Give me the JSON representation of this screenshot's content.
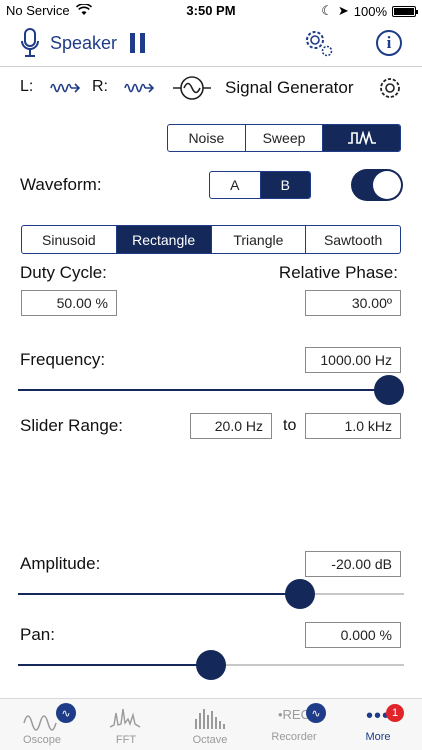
{
  "status_bar": {
    "carrier": "No Service",
    "time": "3:50 PM",
    "battery": "100%"
  },
  "header": {
    "output_label": "Speaker"
  },
  "channels": {
    "left": "L:",
    "right": "R:",
    "title": "Signal Generator"
  },
  "mode_tabs": [
    {
      "label": "Noise",
      "selected": false
    },
    {
      "label": "Sweep",
      "selected": false
    },
    {
      "label": "",
      "selected": true
    }
  ],
  "waveform": {
    "label": "Waveform:",
    "ab": [
      {
        "label": "A",
        "selected": false
      },
      {
        "label": "B",
        "selected": true
      }
    ],
    "toggle_on": true,
    "types": [
      {
        "label": "Sinusoid",
        "selected": false
      },
      {
        "label": "Rectangle",
        "selected": true
      },
      {
        "label": "Triangle",
        "selected": false
      },
      {
        "label": "Sawtooth",
        "selected": false
      }
    ]
  },
  "duty_cycle": {
    "label": "Duty Cycle:",
    "value": "50.00 %"
  },
  "relative_phase": {
    "label": "Relative Phase:",
    "value": "30.00º"
  },
  "frequency": {
    "label": "Frequency:",
    "value": "1000.00 Hz",
    "slider_fraction": 1.0
  },
  "slider_range": {
    "label": "Slider Range:",
    "from": "20.0 Hz",
    "to_label": "to",
    "to": "1.0 kHz"
  },
  "amplitude": {
    "label": "Amplitude:",
    "value": "-20.00 dB",
    "slider_fraction": 0.73
  },
  "pan": {
    "label": "Pan:",
    "value": "0.000 %",
    "slider_fraction": 0.5
  },
  "tab_bar": [
    {
      "label": "Oscope",
      "active": false
    },
    {
      "label": "FFT",
      "active": false
    },
    {
      "label": "Octave",
      "active": false
    },
    {
      "label": "Recorder",
      "active": false
    },
    {
      "label": "More",
      "active": true,
      "badge": "1"
    }
  ],
  "recorder_icon_text": "REC",
  "colors": {
    "accent": "#1f3c88",
    "selected_fill": "#14285a",
    "badge": "#e0242a"
  }
}
